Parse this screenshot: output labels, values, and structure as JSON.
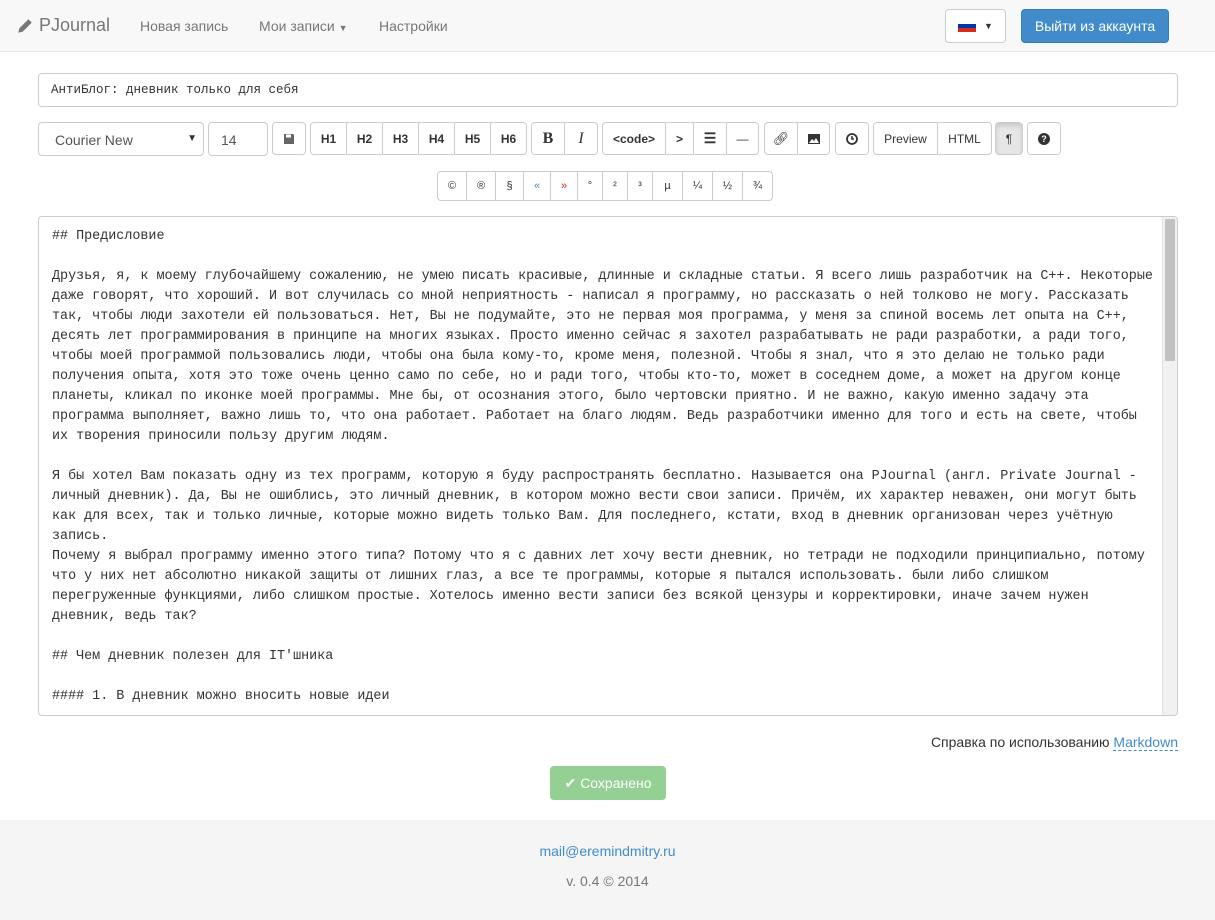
{
  "navbar": {
    "brand": "PJournal",
    "links": [
      "Новая запись",
      "Мои записи",
      "Настройки"
    ],
    "language": "ru",
    "logout_label": "Выйти из аккаунта"
  },
  "title_value": "АнтиБлог: дневник только для себя",
  "toolbar": {
    "font": "Courier New",
    "font_size": "14",
    "headings": [
      "H1",
      "H2",
      "H3",
      "H4",
      "H5",
      "H6"
    ],
    "bold": "B",
    "italic": "I",
    "code": "<code>",
    "quote": ">",
    "hr": "—",
    "preview": "Preview",
    "html": "HTML",
    "pilcrow": "¶",
    "pilcrow_active": true
  },
  "symbols": [
    "©",
    "®",
    "§",
    "«",
    "»",
    "°",
    "²",
    "³",
    "µ",
    "¼",
    "½",
    "¾"
  ],
  "editor_lines": [
    "## Предисловие",
    "",
    "Друзья, я, к моему глубочайшему сожалению, не умею писать красивые, длинные и складные статьи. Я всего лишь разработчик на C++. Некоторые",
    "даже говорят, что хороший. И вот случилась со мной неприятность - написал я программу, но рассказать о ней толково не могу. Рассказать",
    "так, чтобы люди захотели ей пользоваться. Нет, Вы не подумайте, это не первая моя программа, у меня за спиной восемь лет опыта на C++,",
    "десять лет программирования в принципе на многих языках. Просто именно сейчас я захотел разрабатывать не ради разработки, а ради того,",
    "чтобы моей программой пользовались люди, чтобы она была кому-то, кроме меня, полезной. Чтобы я знал, что я это делаю не только ради",
    "получения опыта, хотя это тоже очень ценно само по себе, но и ради того, чтобы кто-то, может в соседнем доме, а может на другом конце",
    "планеты, кликал по иконке моей программы. Мне бы, от осознания этого, было чертовски приятно. И не важно, какую именно задачу эта",
    "программа выполняет, важно лишь то, что она работает. Работает на благо людям. Ведь разработчики именно для того и есть на свете, чтобы",
    "их творения приносили пользу другим людям.",
    "",
    "Я бы хотел Вам показать одну из тех программ, которую я буду распространять бесплатно. Называется она PJournal (англ. Private Journal -",
    "личный дневник). Да, Вы не ошиблись, это личный дневник, в котором можно вести свои записи. Причём, их характер неважен, они могут быть",
    "как для всех, так и только личные, которые можно видеть только Вам. Для последнего, кстати, вход в дневник организован через учётную",
    "запись.",
    "Почему я выбрал программу именно этого типа? Потому что я с давних лет хочу вести дневник, но тетради не подходили принципиально, потому",
    "что у них нет абсолютно никакой защиты от лишних глаз, а все те программы, которые я пытался использовать. были либо слишком",
    "перегруженные функциями, либо слишком простые. Хотелось именно вести записи без всякой цензуры и корректировки, иначе зачем нужен",
    "дневник, ведь так?",
    "",
    "## Чем дневник полезен для IT'шника",
    "",
    "#### 1. В дневник можно вносить новые идеи"
  ],
  "help": {
    "text": "Справка по использованию ",
    "link": "Markdown"
  },
  "saved_label": "Сохранено",
  "footer": {
    "email": "mail@eremindmitry.ru",
    "version": "v. 0.4 © 2014"
  },
  "colors": {
    "primary": "#428bca",
    "success": "#5cb85c",
    "navbar": "#f8f8f8"
  }
}
